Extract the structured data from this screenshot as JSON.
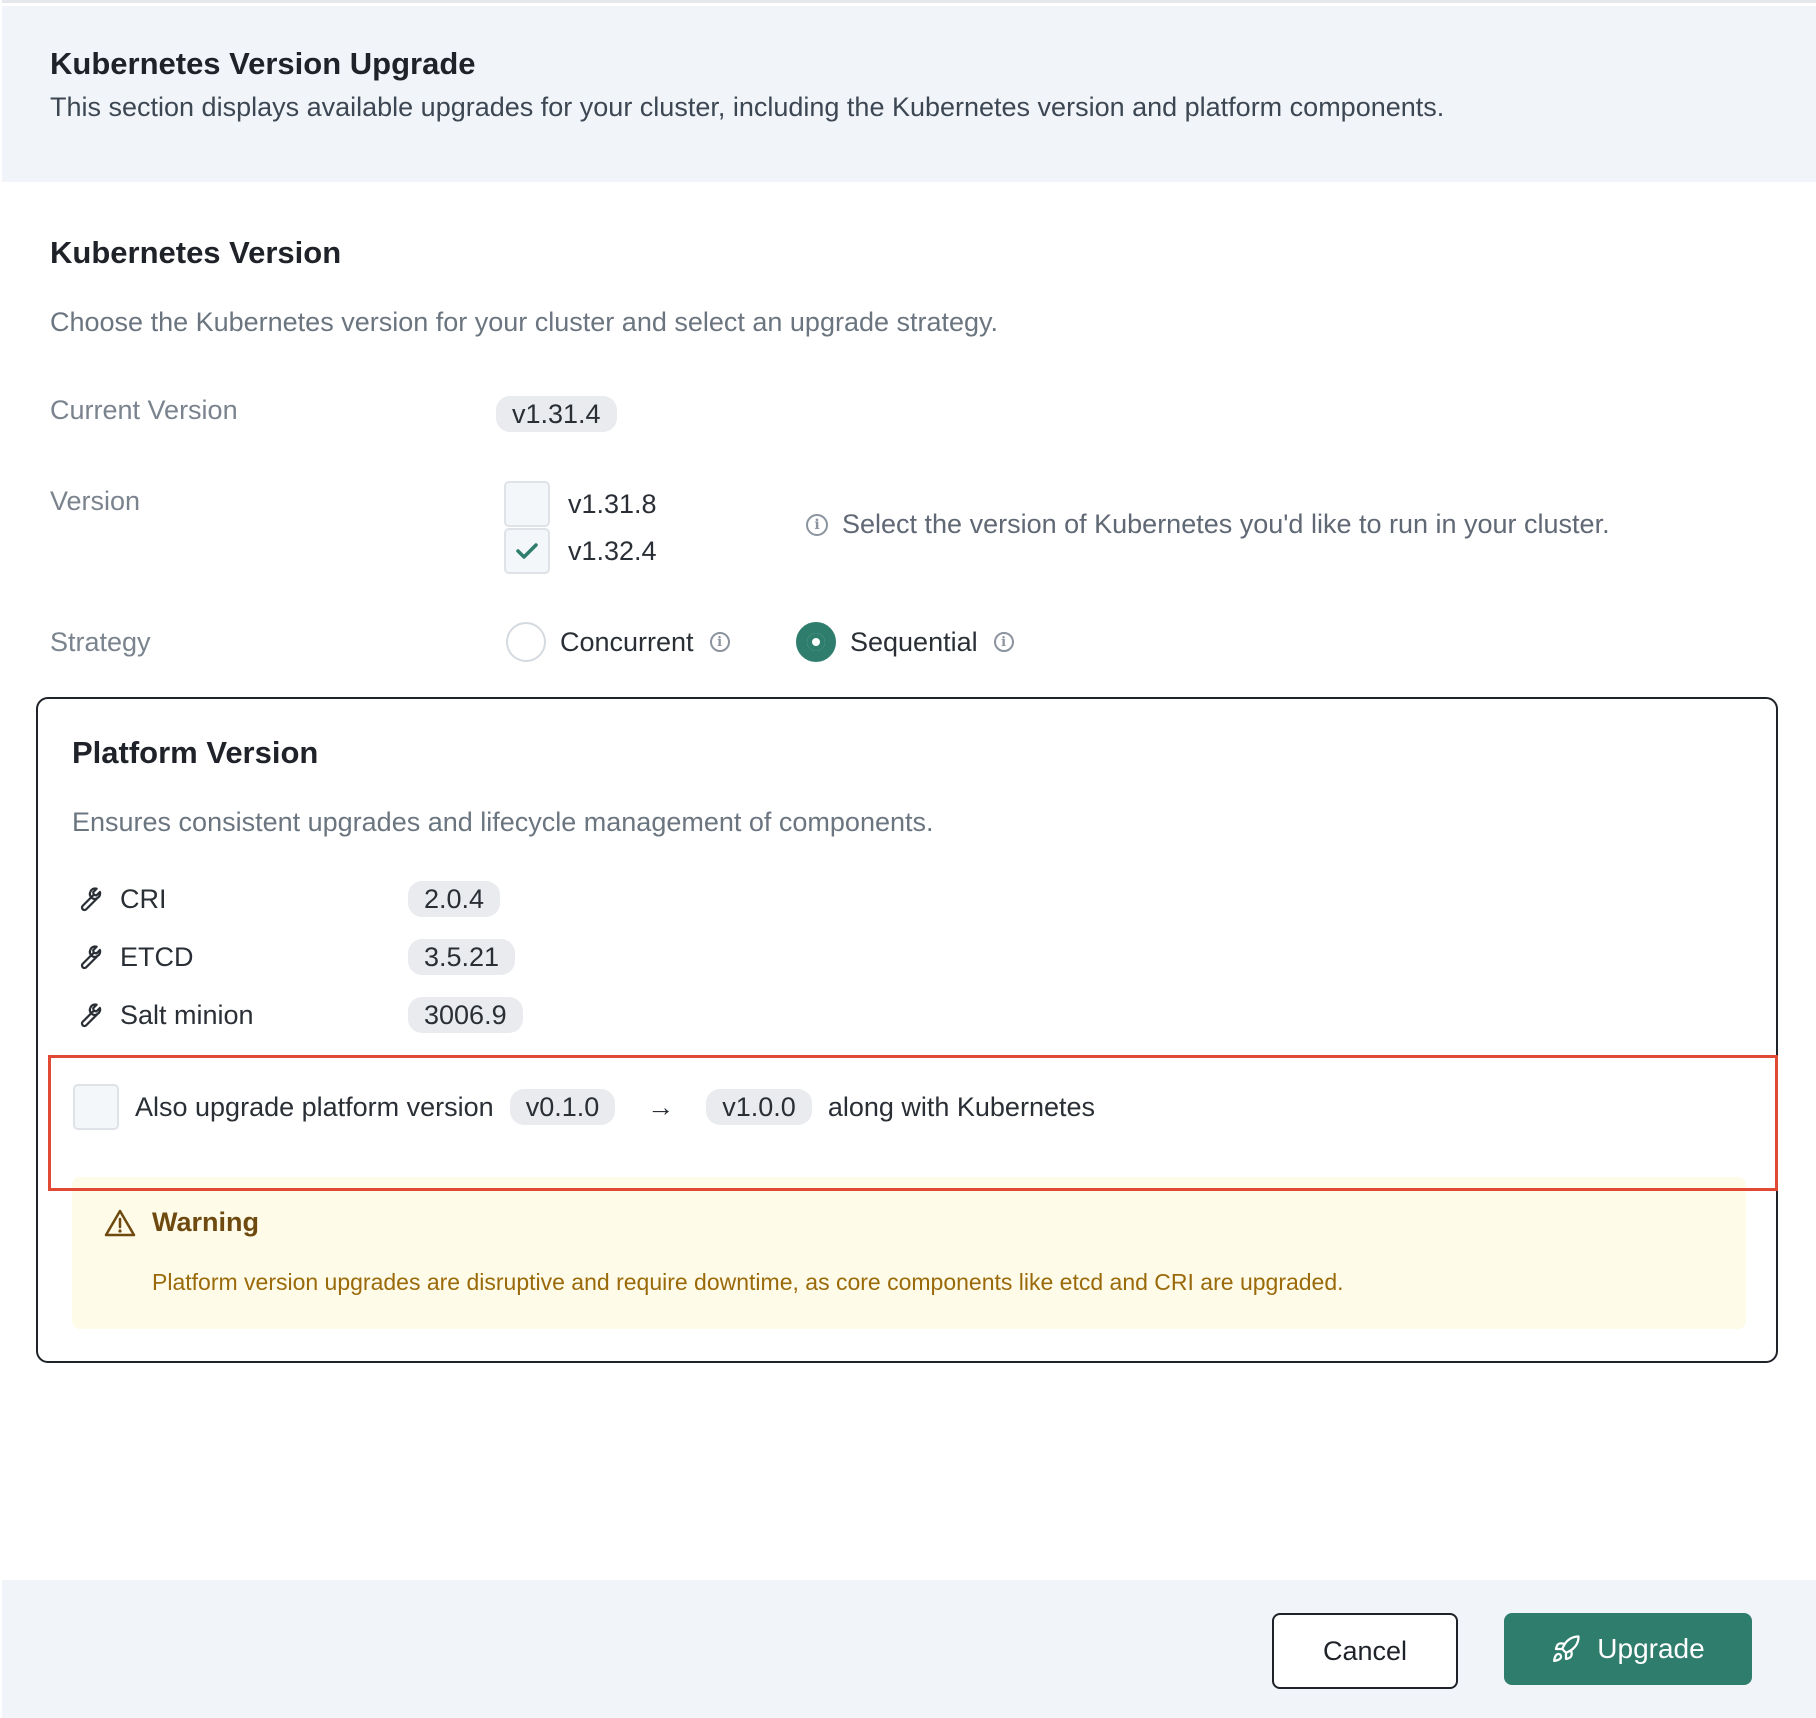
{
  "header": {
    "title": "Kubernetes Version Upgrade",
    "description": "This section displays available upgrades for your cluster, including the Kubernetes version and platform components."
  },
  "kubernetes": {
    "title": "Kubernetes Version",
    "description": "Choose the Kubernetes version for your cluster and select an upgrade strategy.",
    "current_label": "Current Version",
    "current_value": "v1.31.4",
    "version_label": "Version",
    "versions": [
      {
        "label": "v1.31.8",
        "checked": false
      },
      {
        "label": "v1.32.4",
        "checked": true
      }
    ],
    "version_hint": "Select the version of Kubernetes you'd like to run in your cluster.",
    "strategy_label": "Strategy",
    "strategies": [
      {
        "label": "Concurrent",
        "selected": false
      },
      {
        "label": "Sequential",
        "selected": true
      }
    ]
  },
  "platform": {
    "title": "Platform Version",
    "description": "Ensures consistent upgrades and lifecycle management of components.",
    "components": [
      {
        "name": "CRI",
        "version": "2.0.4"
      },
      {
        "name": "ETCD",
        "version": "3.5.21"
      },
      {
        "name": "Salt minion",
        "version": "3006.9"
      }
    ],
    "upgrade_option": {
      "checked": false,
      "text_before": "Also upgrade platform version",
      "from_version": "v0.1.0",
      "arrow": "→",
      "to_version": "v1.0.0",
      "text_after": "along with Kubernetes"
    },
    "warning": {
      "title": "Warning",
      "text": "Platform version upgrades are disruptive and require downtime, as core components like etcd and CRI are upgraded."
    }
  },
  "footer": {
    "cancel_label": "Cancel",
    "upgrade_label": "Upgrade"
  },
  "colors": {
    "accent": "#2f7d6d",
    "highlight_border": "#e04a35",
    "warning_bg": "#fefbe8",
    "warning_text": "#9a6a0a"
  }
}
